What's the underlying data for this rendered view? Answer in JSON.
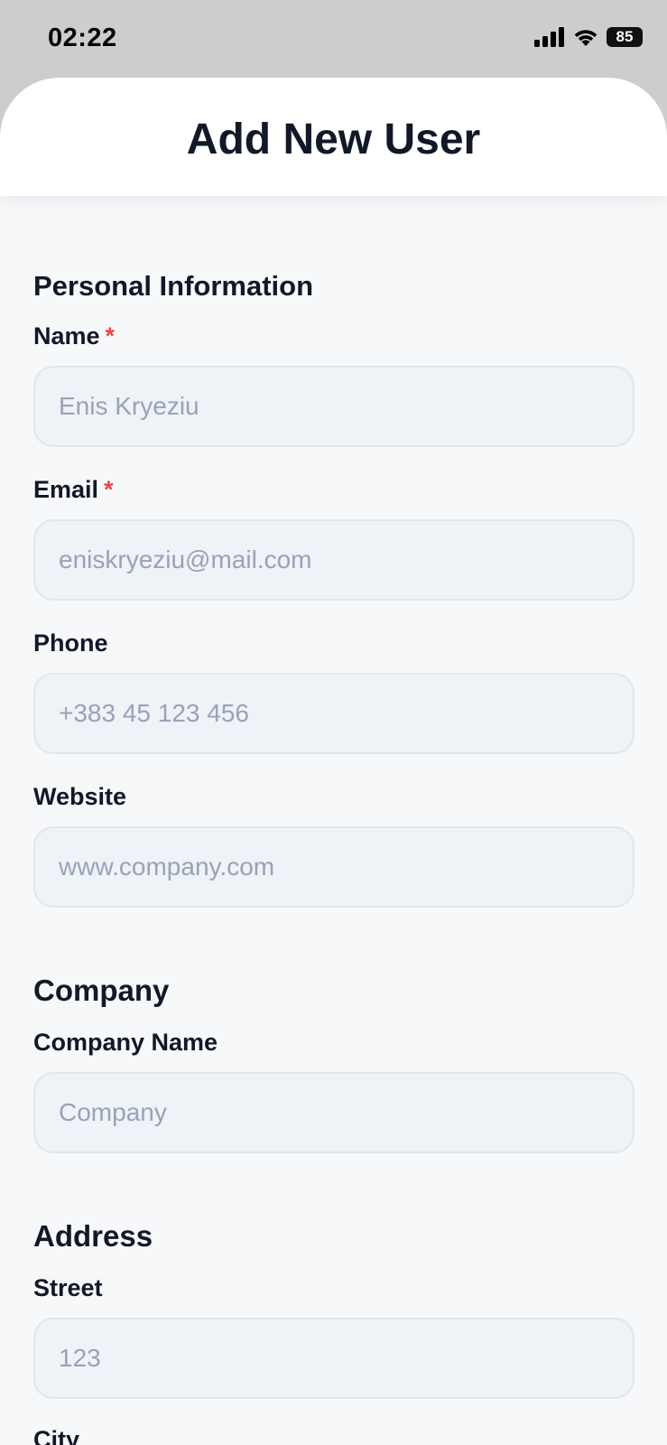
{
  "status_bar": {
    "time": "02:22",
    "battery": "85"
  },
  "header": {
    "title": "Add New User"
  },
  "sections": {
    "personal": {
      "title": "Personal Information",
      "name_label": "Name",
      "name_placeholder": "Enis Kryeziu",
      "email_label": "Email",
      "email_placeholder": "eniskryeziu@mail.com",
      "phone_label": "Phone",
      "phone_placeholder": "+383 45 123 456",
      "website_label": "Website",
      "website_placeholder": "www.company.com",
      "required_mark": "*"
    },
    "company": {
      "title": "Company",
      "company_name_label": "Company Name",
      "company_name_placeholder": "Company"
    },
    "address": {
      "title": "Address",
      "street_label": "Street",
      "street_placeholder": "123",
      "city_label": "City"
    }
  }
}
